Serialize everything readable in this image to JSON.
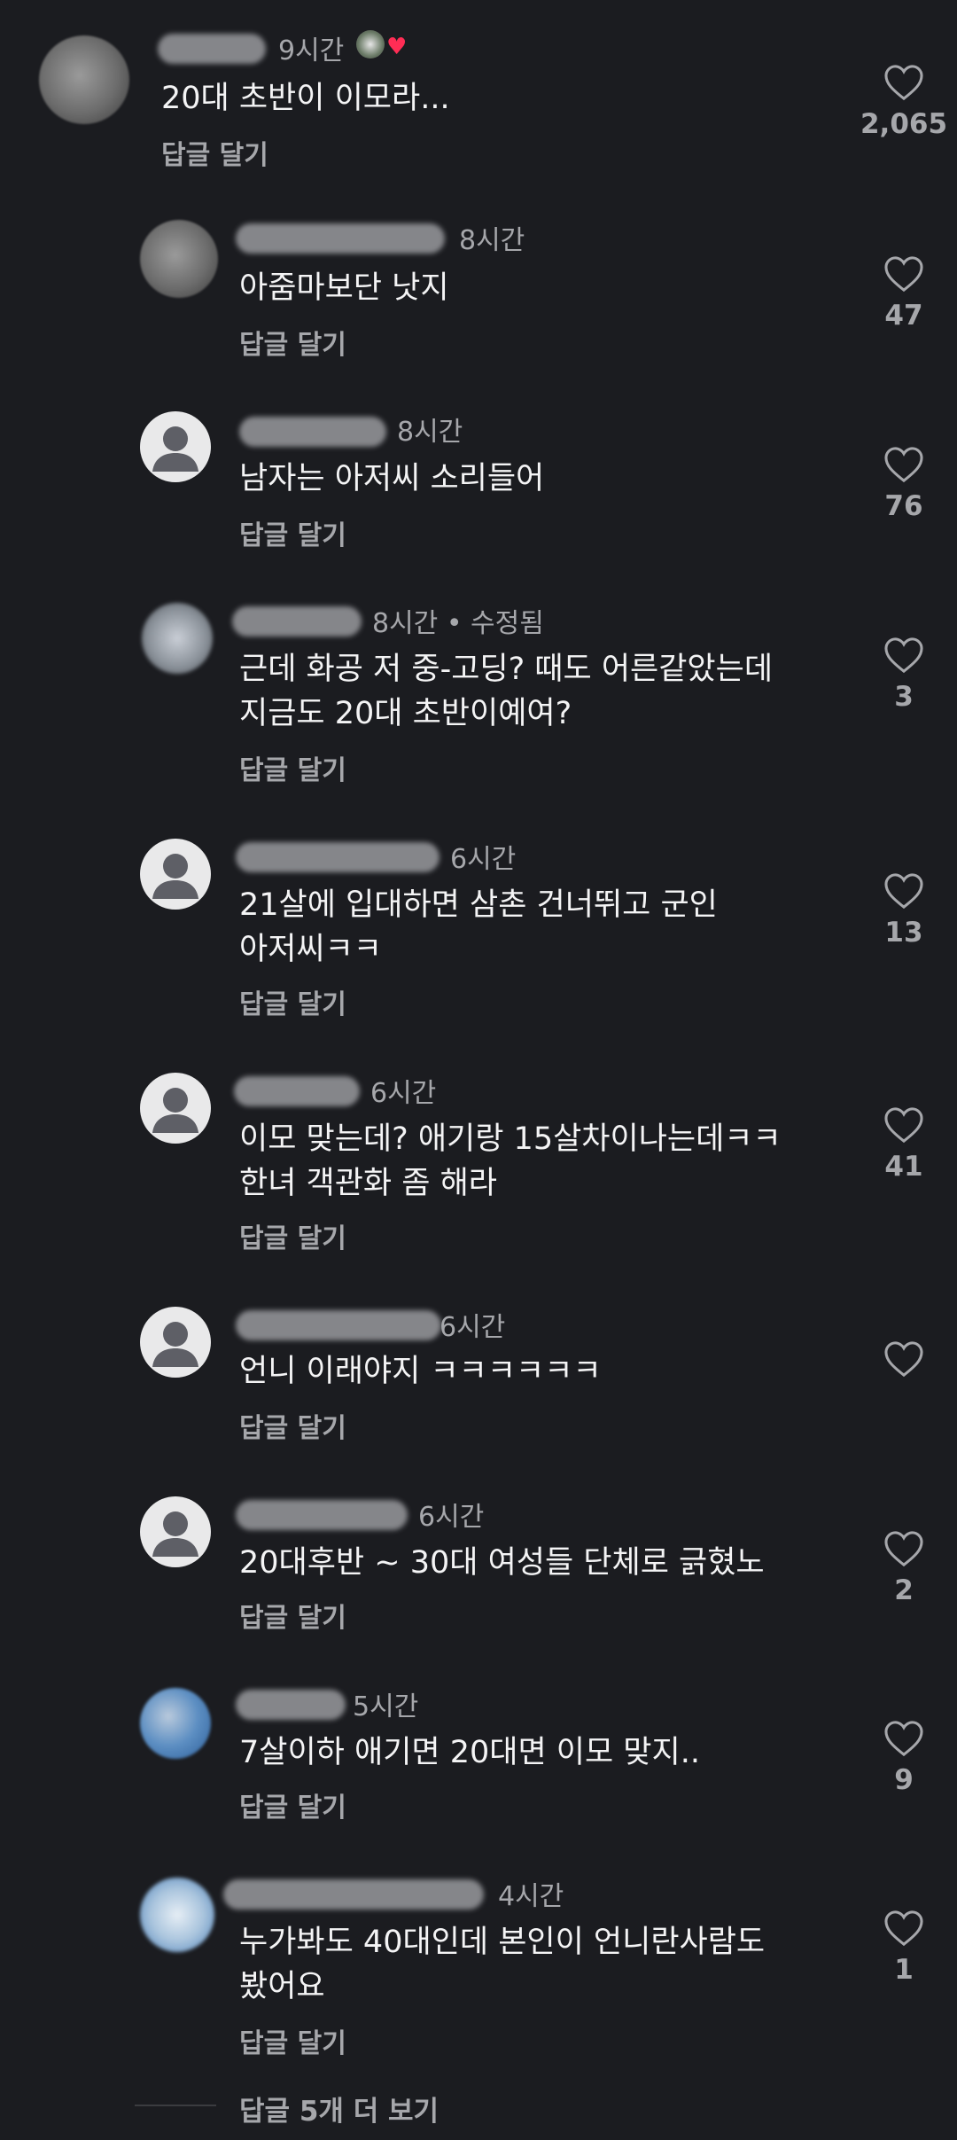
{
  "comments": [
    {
      "time": "9시간",
      "text": [
        "20대 초반이 이모라..."
      ],
      "reply": "답글 달기",
      "likes": "2,065",
      "avatar": "blurred-photo"
    },
    {
      "time": "8시간",
      "text": [
        "아줌마보단 낫지"
      ],
      "reply": "답글 달기",
      "likes": "47",
      "avatar": "blurred-photo"
    },
    {
      "time": "8시간",
      "text": [
        "남자는 아저씨 소리들어"
      ],
      "reply": "답글 달기",
      "likes": "76",
      "avatar": "default-user"
    },
    {
      "time": "8시간 • 수정됨",
      "text": [
        "근데 화공 저 중-고딩? 때도 어른같았는데",
        "지금도 20대 초반이예여?"
      ],
      "reply": "답글 달기",
      "likes": "3",
      "avatar": "blurred-photo"
    },
    {
      "time": "6시간",
      "text": [
        "21살에 입대하면 삼촌 건너뛰고 군인",
        "아저씨ㅋㅋ"
      ],
      "reply": "답글 달기",
      "likes": "13",
      "avatar": "default-user"
    },
    {
      "time": "6시간",
      "text": [
        "이모 맞는데? 애기랑 15살차이나는데ㅋㅋ",
        "한녀 객관화 좀 해라"
      ],
      "reply": "답글 달기",
      "likes": "41",
      "avatar": "default-user"
    },
    {
      "time": "6시간",
      "text": [
        "언니 이래야지 ㅋㅋㅋㅋㅋㅋ"
      ],
      "reply": "답글 달기",
      "likes": "",
      "avatar": "default-user"
    },
    {
      "time": "6시간",
      "text": [
        "20대후반 ~ 30대 여성들 단체로 긁혔노"
      ],
      "reply": "답글 달기",
      "likes": "2",
      "avatar": "default-user"
    },
    {
      "time": "5시간",
      "text": [
        "7살이하 애기면 20대면 이모 맞지.."
      ],
      "reply": "답글 달기",
      "likes": "9",
      "avatar": "blurred-photo"
    },
    {
      "time": "4시간",
      "text": [
        "누가봐도 40대인데 본인이 언니란사람도",
        "봤어요"
      ],
      "reply": "답글 달기",
      "likes": "1",
      "avatar": "blurred-photo"
    }
  ],
  "footer": {
    "more_replies": "답글 5개 더 보기"
  },
  "colors": {
    "background": "#1b1c20",
    "text": "#f4f4f5",
    "secondary": "#a6a7ab",
    "badge_heart": "#ff2d55"
  }
}
